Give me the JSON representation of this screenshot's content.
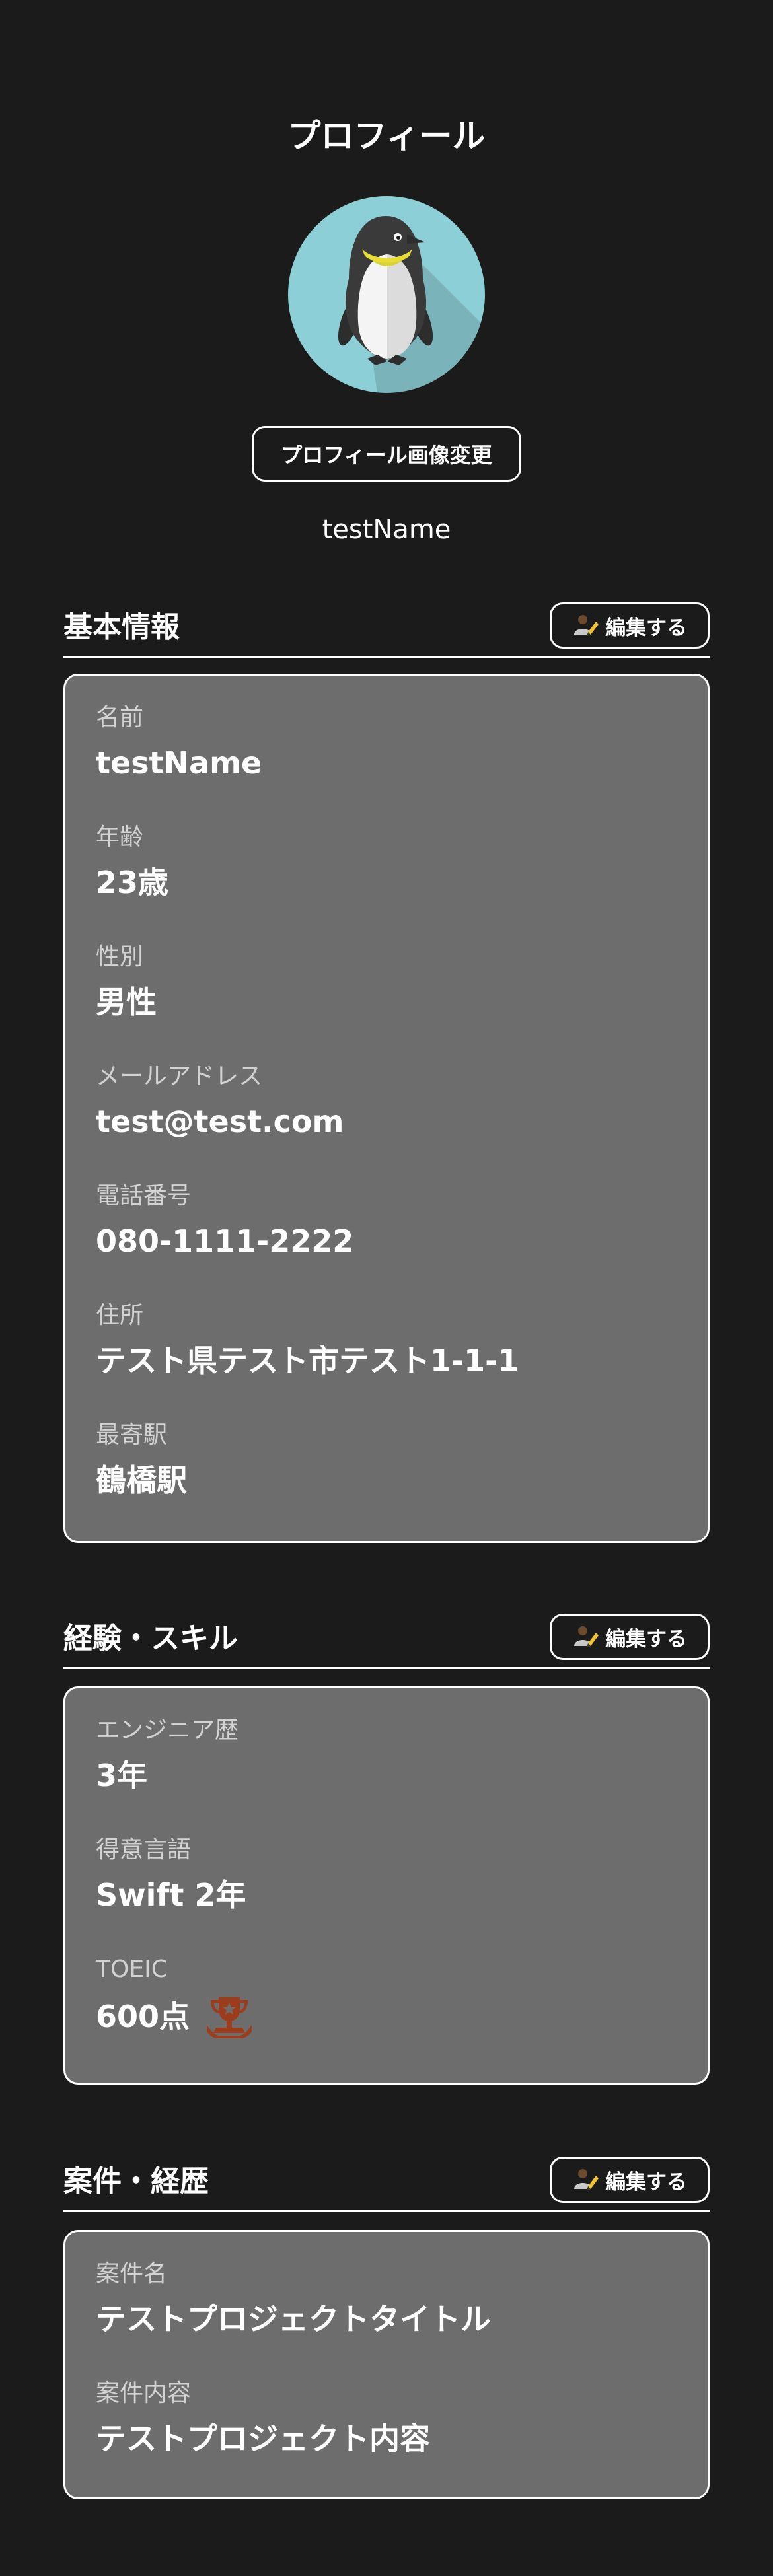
{
  "header": {
    "title": "プロフィール"
  },
  "profile": {
    "change_photo_label": "プロフィール画像変更",
    "name": "testName",
    "avatar_icon": "penguin-icon"
  },
  "colors": {
    "background": "#1b1b1b",
    "card": "#6d6d6d",
    "avatar_bg": "#8dcfd6",
    "trophy": "#9b3d1d",
    "text": "#ffffff",
    "label": "#d2d2d2"
  },
  "sections": {
    "basic": {
      "title": "基本情報",
      "edit_label": "編集する",
      "fields": [
        {
          "label": "名前",
          "value": "testName"
        },
        {
          "label": "年齢",
          "value": "23歳"
        },
        {
          "label": "性別",
          "value": "男性"
        },
        {
          "label": "メールアドレス",
          "value": "test@test.com"
        },
        {
          "label": "電話番号",
          "value": "080-1111-2222"
        },
        {
          "label": "住所",
          "value": "テスト県テスト市テスト1-1-1"
        },
        {
          "label": "最寄駅",
          "value": "鶴橋駅"
        }
      ]
    },
    "skills": {
      "title": "経験・スキル",
      "edit_label": "編集する",
      "fields": [
        {
          "label": "エンジニア歴",
          "value": "3年"
        },
        {
          "label": "得意言語",
          "value": "Swift  2年"
        },
        {
          "label": "TOEIC",
          "value": "600点",
          "icon": "trophy-icon"
        }
      ]
    },
    "projects": {
      "title": "案件・経歴",
      "edit_label": "編集する",
      "fields": [
        {
          "label": "案件名",
          "value": "テストプロジェクトタイトル"
        },
        {
          "label": "案件内容",
          "value": "テストプロジェクト内容"
        }
      ]
    }
  }
}
